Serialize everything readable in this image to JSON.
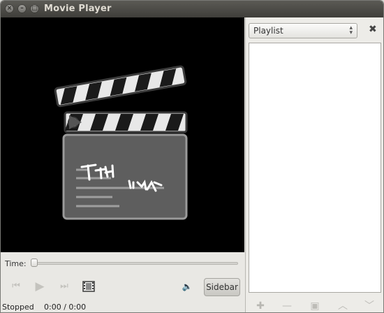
{
  "window": {
    "title": "Movie Player"
  },
  "titlebar_buttons": [
    {
      "name": "close",
      "glyph": "×"
    },
    {
      "name": "minimize",
      "glyph": "–"
    },
    {
      "name": "maximize",
      "glyph": "□"
    }
  ],
  "sidebar": {
    "combo_value": "Playlist",
    "close_glyph": "✖",
    "buttons": [
      {
        "name": "add",
        "glyph": "✚"
      },
      {
        "name": "remove",
        "glyph": "—"
      },
      {
        "name": "copy",
        "glyph": "▣"
      },
      {
        "name": "move-up",
        "glyph": "︿"
      },
      {
        "name": "move-down",
        "glyph": "﹀"
      }
    ]
  },
  "seek": {
    "label": "Time:",
    "position": 0
  },
  "controls": {
    "previous": "⏮",
    "play": "▶",
    "next": "⏭",
    "volume": "🔈",
    "sidebar_toggle": "Sidebar"
  },
  "status": {
    "state": "Stopped",
    "time": "0:00 / 0:00"
  },
  "colors": {
    "video_bg": "#000000",
    "titlebar": "#3f3e3a",
    "window_bg": "#e9e8e4"
  }
}
